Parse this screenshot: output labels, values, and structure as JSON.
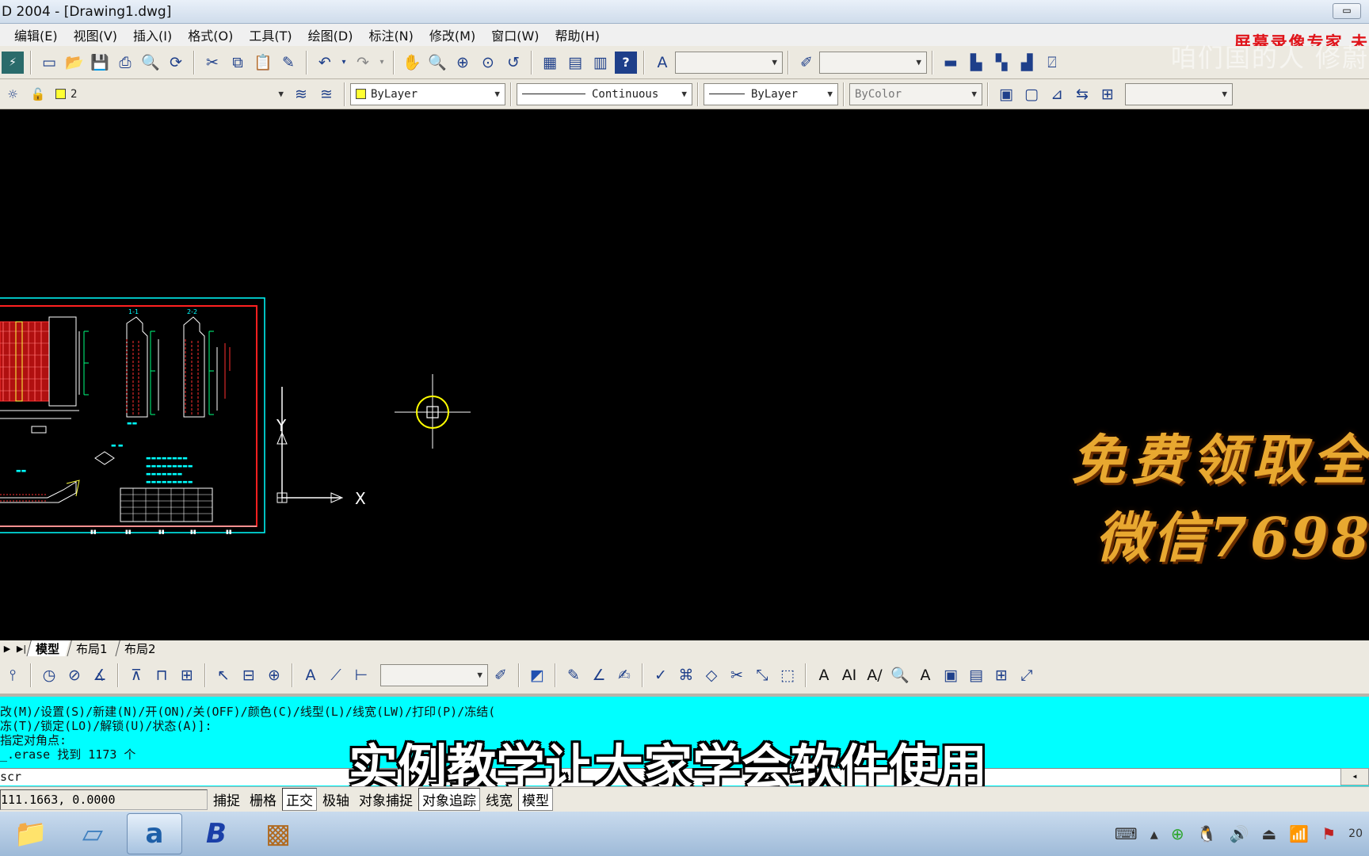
{
  "window": {
    "title": "D 2004 - [Drawing1.dwg]",
    "min_button": "▭"
  },
  "menu": [
    "编辑(E)",
    "视图(V)",
    "插入(I)",
    "格式(O)",
    "工具(T)",
    "绘图(D)",
    "标注(N)",
    "修改(M)",
    "窗口(W)",
    "帮助(H)"
  ],
  "overlay": {
    "recorder": "屏幕录像专家 未",
    "watermark": "咱们国的人 修蔚"
  },
  "layers": {
    "current_layer": "2",
    "color": "ByLayer",
    "linetype": "Continuous",
    "lineweight": "ByLayer",
    "plotstyle": "ByColor"
  },
  "canvas": {
    "axis_y": "Y",
    "axis_x": "X"
  },
  "promo": {
    "line1": "免费领取全",
    "line2": "微信7698"
  },
  "tabs": [
    {
      "label": "模型"
    },
    {
      "label": "布局1"
    },
    {
      "label": "布局2"
    }
  ],
  "command": {
    "line1": "改(M)/设置(S)/新建(N)/开(ON)/关(OFF)/颜色(C)/线型(L)/线宽(LW)/打印(P)/冻结(",
    "line2": "冻(T)/锁定(LO)/解锁(U)/状态(A)]:",
    "line3": "指定对角点:",
    "line4": "_.erase 找到 1173 个",
    "prompt": "scr"
  },
  "subtitle": "实例教学让大家学会软件使用",
  "status": {
    "coords": "111.1663, 0.0000",
    "buttons": [
      {
        "label": "捕捉",
        "on": false
      },
      {
        "label": "栅格",
        "on": false
      },
      {
        "label": "正交",
        "on": true
      },
      {
        "label": "极轴",
        "on": false
      },
      {
        "label": "对象捕捉",
        "on": false
      },
      {
        "label": "对象追踪",
        "on": true
      },
      {
        "label": "线宽",
        "on": false
      },
      {
        "label": "模型",
        "on": true
      }
    ]
  },
  "tray": {
    "clock": "20"
  }
}
